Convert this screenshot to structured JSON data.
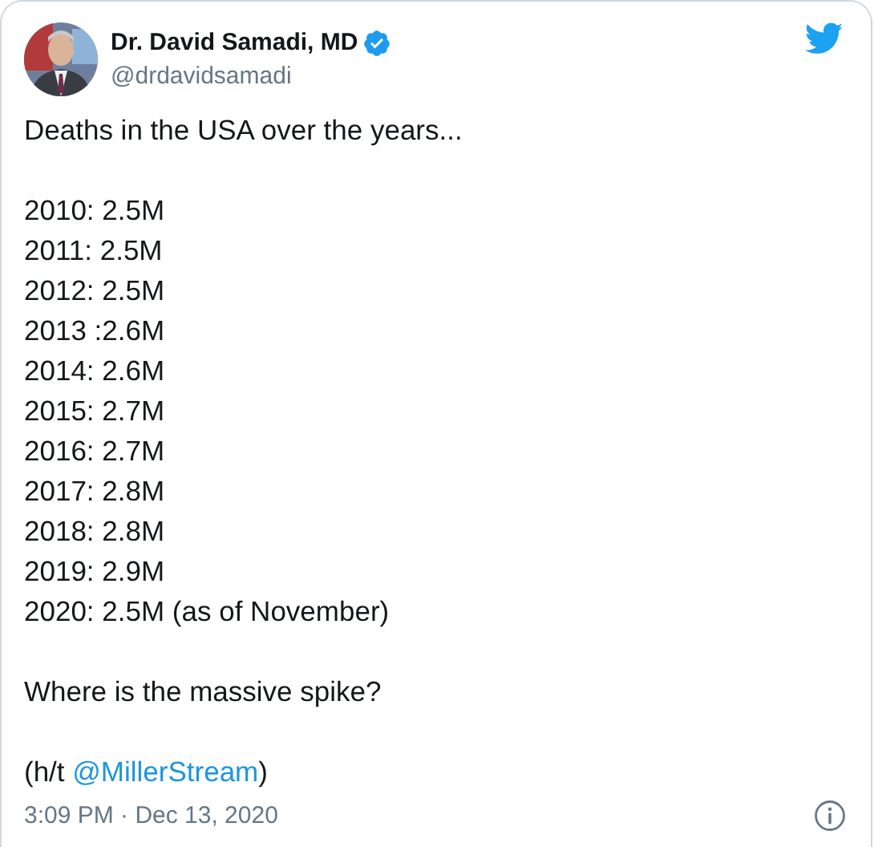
{
  "author": {
    "name": "Dr. David Samadi, MD",
    "verified": true,
    "handle": "@drdavidsamadi"
  },
  "paragraphs": [
    {
      "lines": [
        "Deaths in the USA over the years..."
      ]
    },
    {
      "lines": [
        "2010: 2.5M",
        "2011: 2.5M",
        "2012: 2.5M",
        "2013 :2.6M",
        "2014: 2.6M",
        "2015: 2.7M",
        "2016: 2.7M",
        "2017: 2.8M",
        "2018: 2.8M",
        "2019: 2.9M",
        "2020: 2.5M (as of November)"
      ]
    },
    {
      "lines": [
        "Where is the massive spike?"
      ]
    }
  ],
  "credit": {
    "prefix": "(h/t ",
    "mention": "@MillerStream",
    "suffix": ")"
  },
  "timestamp": "3:09 PM · Dec 13, 2020"
}
